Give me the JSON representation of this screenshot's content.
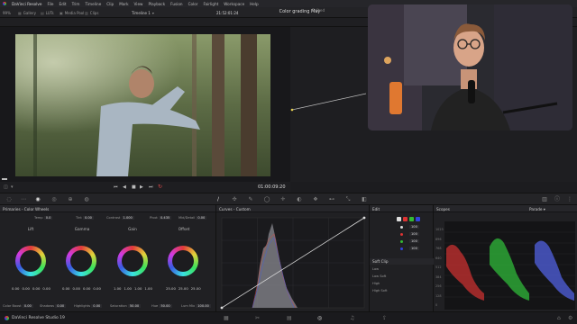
{
  "menubar": {
    "app": "DaVinci Resolve",
    "items": [
      "File",
      "Edit",
      "Trim",
      "Timeline",
      "Clip",
      "Mark",
      "View",
      "Playback",
      "Fusion",
      "Color",
      "Fairlight",
      "Workspace",
      "Help"
    ]
  },
  "toolbar": {
    "zoom": "99%",
    "tabs": [
      "Gallery",
      "LUTs",
      "Media Pool",
      "Clips"
    ],
    "timeline": "Timeline 1",
    "timecode": "21:52:01:24",
    "project_title": "Color grading May",
    "project_status": "Edited"
  },
  "transport": {
    "timecode": "01:00:09:20"
  },
  "primaries": {
    "title": "Primaries - Color Wheels",
    "top_params": [
      {
        "label": "Temp",
        "value": "0.0"
      },
      {
        "label": "Tint",
        "value": "0.00"
      },
      {
        "label": "Contrast",
        "value": "1.000"
      },
      {
        "label": "Pivot",
        "value": "0.435"
      },
      {
        "label": "Mid/Detail",
        "value": "0.00"
      }
    ],
    "wheels": [
      {
        "name": "Lift",
        "values": [
          "0.00",
          "0.00",
          "0.00",
          "0.00"
        ]
      },
      {
        "name": "Gamma",
        "values": [
          "0.00",
          "0.00",
          "0.00",
          "0.00"
        ]
      },
      {
        "name": "Gain",
        "values": [
          "1.00",
          "1.00",
          "1.00",
          "1.00"
        ]
      },
      {
        "name": "Offset",
        "values": [
          "25.00",
          "25.00",
          "25.00"
        ]
      }
    ],
    "bottom_params": [
      {
        "label": "Color Boost",
        "value": "0.00"
      },
      {
        "label": "Shadows",
        "value": "0.00"
      },
      {
        "label": "Highlights",
        "value": "0.00"
      },
      {
        "label": "Saturation",
        "value": "50.00"
      },
      {
        "label": "Hue",
        "value": "50.00"
      },
      {
        "label": "Lum Mix",
        "value": "100.00"
      }
    ]
  },
  "curves": {
    "title": "Curves - Custom"
  },
  "edit": {
    "title": "Edit",
    "rows": [
      {
        "value": "100"
      },
      {
        "value": "100"
      },
      {
        "value": "100"
      },
      {
        "value": "100"
      }
    ],
    "soft_clip_title": "Soft Clip",
    "soft_clip_rows": [
      "Low",
      "Low Soft",
      "High",
      "High Soft"
    ]
  },
  "scopes": {
    "title": "Scopes",
    "mode": "Parade",
    "scale": [
      "1023",
      "896",
      "768",
      "640",
      "512",
      "384",
      "256",
      "128",
      "0"
    ]
  },
  "statusbar": {
    "app": "DaVinci Resolve Studio 19"
  },
  "colors": {
    "accent": "#e14a4a",
    "curve": "#dddddd"
  }
}
